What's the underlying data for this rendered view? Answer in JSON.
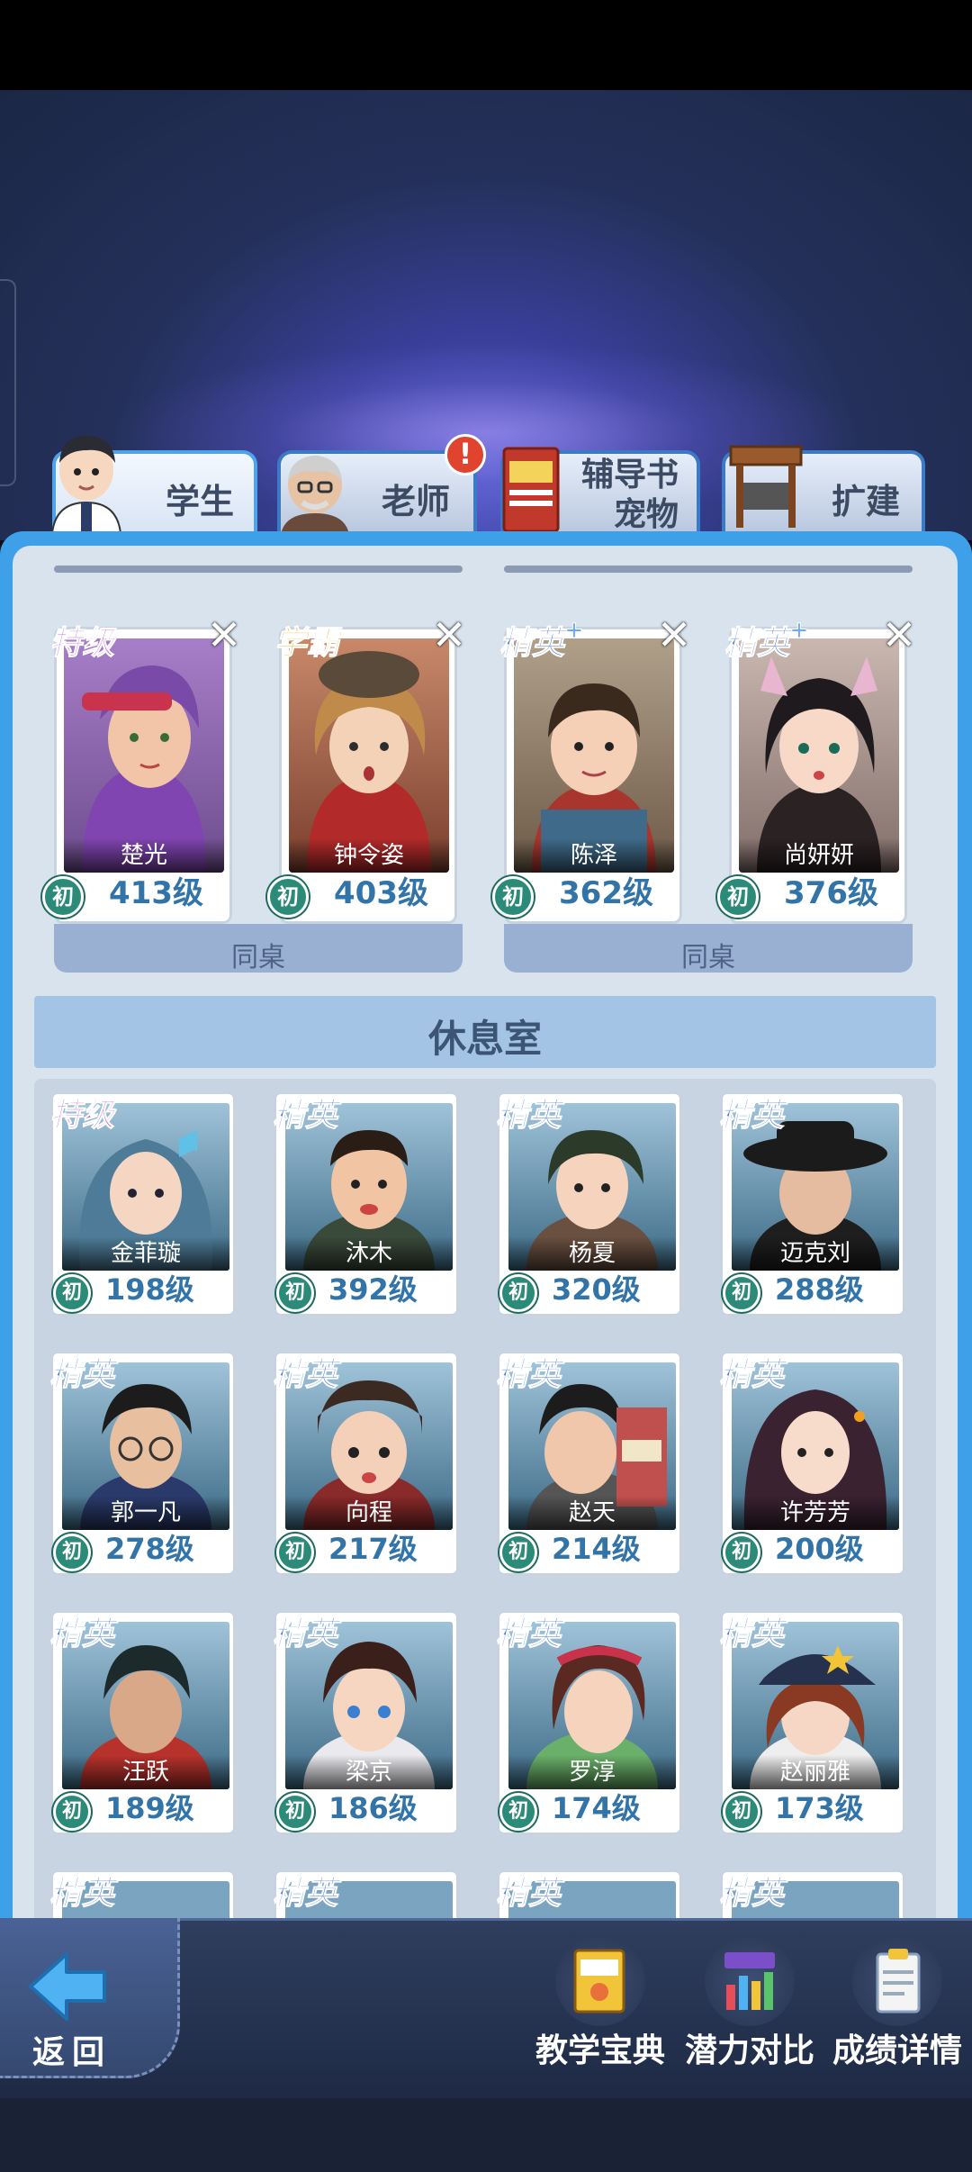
{
  "tabs": {
    "students": "学生",
    "teachers": "老师",
    "books": "辅导书",
    "pets": "宠物",
    "expand": "扩建"
  },
  "deskmates": {
    "group_label": "同桌",
    "cards": [
      {
        "rank": "特级",
        "name": "楚光",
        "badge": "初",
        "level": "413级"
      },
      {
        "rank": "学霸",
        "name": "钟令姿",
        "badge": "初",
        "level": "403级"
      },
      {
        "rank": "精英",
        "name": "陈泽",
        "badge": "初",
        "level": "362级"
      },
      {
        "rank": "精英",
        "name": "尚妍妍",
        "badge": "初",
        "level": "376级"
      }
    ]
  },
  "rest_room": {
    "title": "休息室",
    "cards": [
      {
        "rank": "特级",
        "name": "金菲璇",
        "badge": "初",
        "level": "198级"
      },
      {
        "rank": "精英",
        "name": "沐木",
        "badge": "初",
        "level": "392级"
      },
      {
        "rank": "精英",
        "name": "杨夏",
        "badge": "初",
        "level": "320级"
      },
      {
        "rank": "精英",
        "name": "迈克刘",
        "badge": "初",
        "level": "288级"
      },
      {
        "rank": "精英",
        "name": "郭一凡",
        "badge": "初",
        "level": "278级"
      },
      {
        "rank": "精英",
        "name": "向程",
        "badge": "初",
        "level": "217级"
      },
      {
        "rank": "精英",
        "name": "赵天",
        "badge": "初",
        "level": "214级"
      },
      {
        "rank": "精英",
        "name": "许芳芳",
        "badge": "初",
        "level": "200级"
      },
      {
        "rank": "精英",
        "name": "汪跃",
        "badge": "初",
        "level": "189级"
      },
      {
        "rank": "精英",
        "name": "梁京",
        "badge": "初",
        "level": "186级"
      },
      {
        "rank": "精英",
        "name": "罗淳",
        "badge": "初",
        "level": "174级"
      },
      {
        "rank": "精英",
        "name": "赵丽雅",
        "badge": "初",
        "level": "173级"
      }
    ],
    "partial_row_ranks": [
      "精英",
      "精英",
      "精英",
      "精英"
    ]
  },
  "bottom": {
    "back": "返回",
    "teaching_guide": "教学宝典",
    "potential_compare": "潜力对比",
    "score_details": "成绩详情"
  },
  "icons": {
    "back": "arrow-left-icon",
    "teaching_guide": "book-icon",
    "potential_compare": "bar-chart-icon",
    "score_details": "clipboard-icon",
    "teacher_alert": "exclamation-icon"
  },
  "colors": {
    "panel_border": "#3ea0e8",
    "panel_bg": "#d9e3ee",
    "level_text": "#3374a8",
    "rank_special": "#c060e0",
    "rank_xueba": "#f0b020",
    "rank_elite": "#4b79e0",
    "badge": "#2b8a78"
  }
}
